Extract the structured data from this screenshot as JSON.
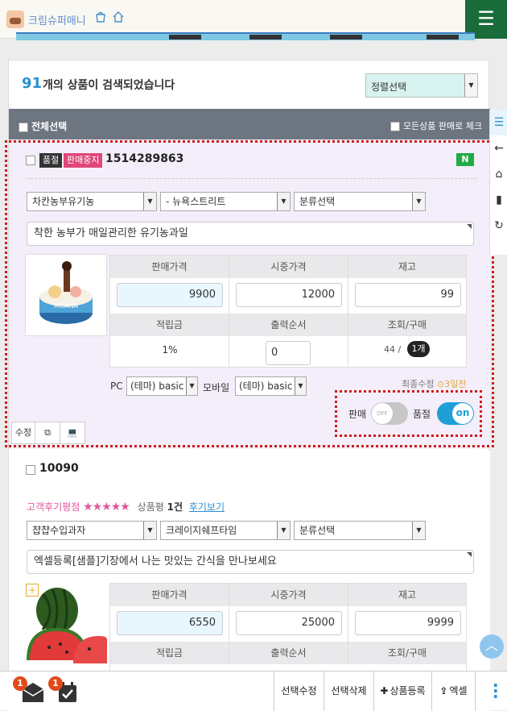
{
  "header": {
    "brand": "크림슈퍼매니",
    "menu_icon": "hamburger-icon"
  },
  "results": {
    "count": "91",
    "text": "개의 상품이 검색되었습니다",
    "sort_label": "정렬선택"
  },
  "select_bar": {
    "all_label": "전체선택",
    "mark_label": "모든상품 판매로 체크"
  },
  "product1": {
    "tag_soldout": "품절",
    "tag_stopped": "판매중지",
    "id": "1514289863",
    "new_badge": "N",
    "dropdowns": [
      "차칸농부유기농",
      "- 뉴욕스트리트",
      "분류선택"
    ],
    "description": "착한 농부가 매일관리한 유기농과일",
    "headers": [
      "판매가격",
      "시중가격",
      "재고"
    ],
    "values": [
      "9900",
      "12000",
      "99"
    ],
    "headers2": [
      "적립금",
      "출력순서",
      "조회/구매"
    ],
    "points": "1%",
    "order": "0",
    "views": "44 /",
    "purchases": "1개",
    "pc_label": "PC",
    "pc_theme": "(테마) basic",
    "mobile_label": "모바일",
    "mobile_theme": "(테마) basic",
    "recent_label": "최종수정",
    "recent_time": "3일전",
    "sale_label": "판매",
    "sale_switch": "OFF",
    "soldout_label": "품절",
    "soldout_switch": "on",
    "buttons": [
      "수정",
      "copy-icon",
      "laptop-icon"
    ]
  },
  "product2": {
    "id": "10090",
    "review_label": "고객후기평점",
    "rating_text": "상품평",
    "review_count": "1건",
    "review_link": "후기보기",
    "dropdowns": [
      "챱챱수입과자",
      "크레이지쉐프타임",
      "분류선택"
    ],
    "description": "엑셀등록[샘플]기장에서 나는 맛있는 간식을 만나보세요",
    "headers": [
      "판매가격",
      "시중가격",
      "재고"
    ],
    "values": [
      "6550",
      "25000",
      "9999"
    ],
    "headers2": [
      "적립금",
      "출력순서",
      "조회/구매"
    ]
  },
  "bottom": {
    "mail_badge": "1",
    "task_badge": "1",
    "btn_edit": "선택수정",
    "btn_delete": "선택삭제",
    "btn_register": "상품등록",
    "btn_excel": "엑셀"
  }
}
